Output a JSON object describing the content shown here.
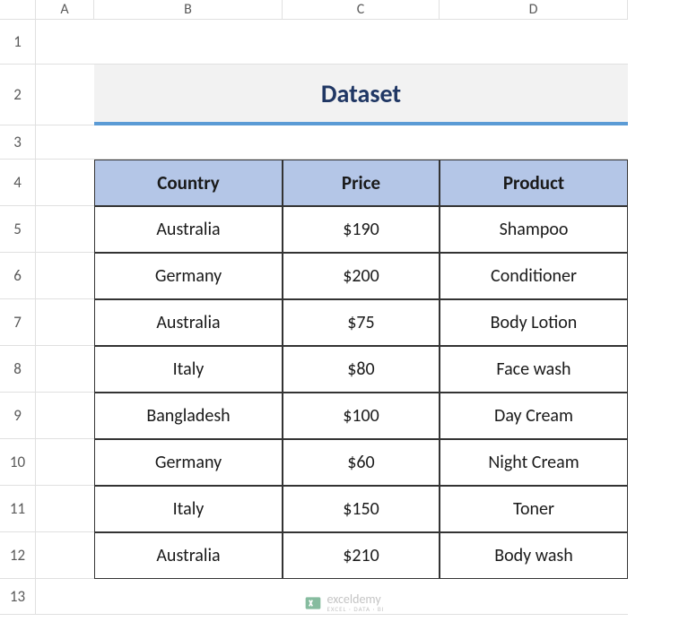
{
  "columns": [
    "A",
    "B",
    "C",
    "D"
  ],
  "rows": [
    "1",
    "2",
    "3",
    "4",
    "5",
    "6",
    "7",
    "8",
    "9",
    "10",
    "11",
    "12",
    "13"
  ],
  "title": "Dataset",
  "table": {
    "headers": [
      "Country",
      "Price",
      "Product"
    ],
    "data": [
      [
        "Australia",
        "$190",
        "Shampoo"
      ],
      [
        "Germany",
        "$200",
        "Conditioner"
      ],
      [
        "Australia",
        "$75",
        "Body Lotion"
      ],
      [
        "Italy",
        "$80",
        "Face wash"
      ],
      [
        "Bangladesh",
        "$100",
        "Day Cream"
      ],
      [
        "Germany",
        "$60",
        "Night Cream"
      ],
      [
        "Italy",
        "$150",
        "Toner"
      ],
      [
        "Australia",
        "$210",
        "Body wash"
      ]
    ]
  },
  "watermark": {
    "text": "exceldemy",
    "subtext": "EXCEL · DATA · BI"
  }
}
